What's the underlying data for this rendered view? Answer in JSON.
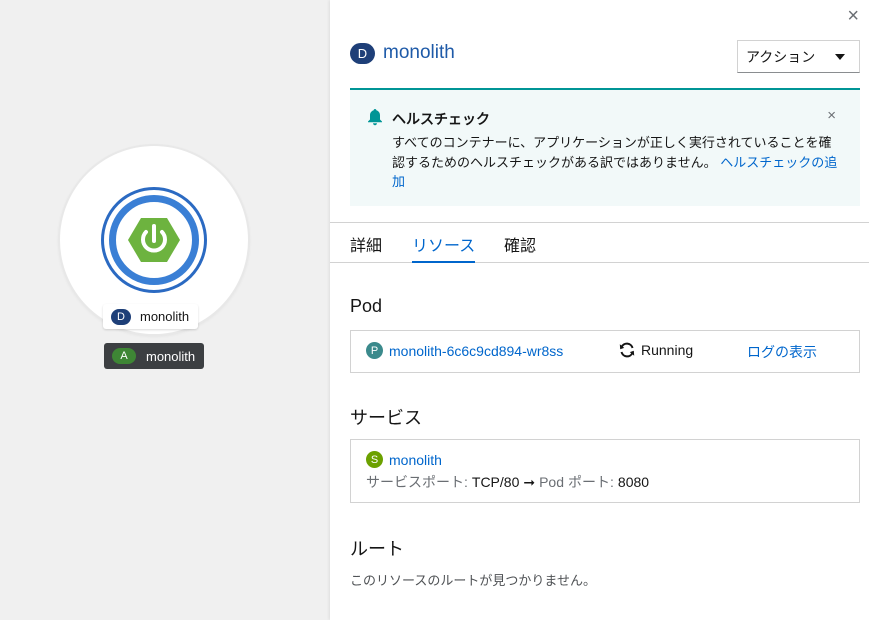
{
  "topology": {
    "node_badge": "D",
    "node_label": "monolith",
    "app_badge": "A",
    "app_label": "monolith",
    "node_icon": "power-icon",
    "colors": {
      "ring": "#2b6ac2",
      "hexagon": "#6db33f",
      "app_label_bg": "#3c3f42"
    }
  },
  "panel": {
    "close_icon": "×",
    "header": {
      "badge": "D",
      "title": "monolith"
    },
    "actions": {
      "label": "アクション"
    },
    "alert": {
      "title": "ヘルスチェック",
      "body": "すべてのコンテナーに、アプリケーションが正しく実行されていることを確認するためのヘルスチェックがある訳ではありません。",
      "link": "ヘルスチェックの追加",
      "close_icon": "×"
    },
    "tabs": [
      {
        "label": "詳細"
      },
      {
        "label": "リソース",
        "active": true
      },
      {
        "label": "確認"
      }
    ],
    "pod": {
      "section_title": "Pod",
      "badge": "P",
      "name": "monolith-6c6c9cd894-wr8ss",
      "status": "Running",
      "logs_link": "ログの表示"
    },
    "services": {
      "section_title": "サービス",
      "badge": "S",
      "name": "monolith",
      "port_label": "サービスポート:",
      "port_value": "TCP/80",
      "arrow": "➞",
      "pod_port_label_a": "Pod",
      "pod_port_label_b": "ポート:",
      "pod_port_value": "8080"
    },
    "routes": {
      "section_title": "ルート",
      "empty_text": "このリソースのルートが見つかりません。"
    }
  }
}
